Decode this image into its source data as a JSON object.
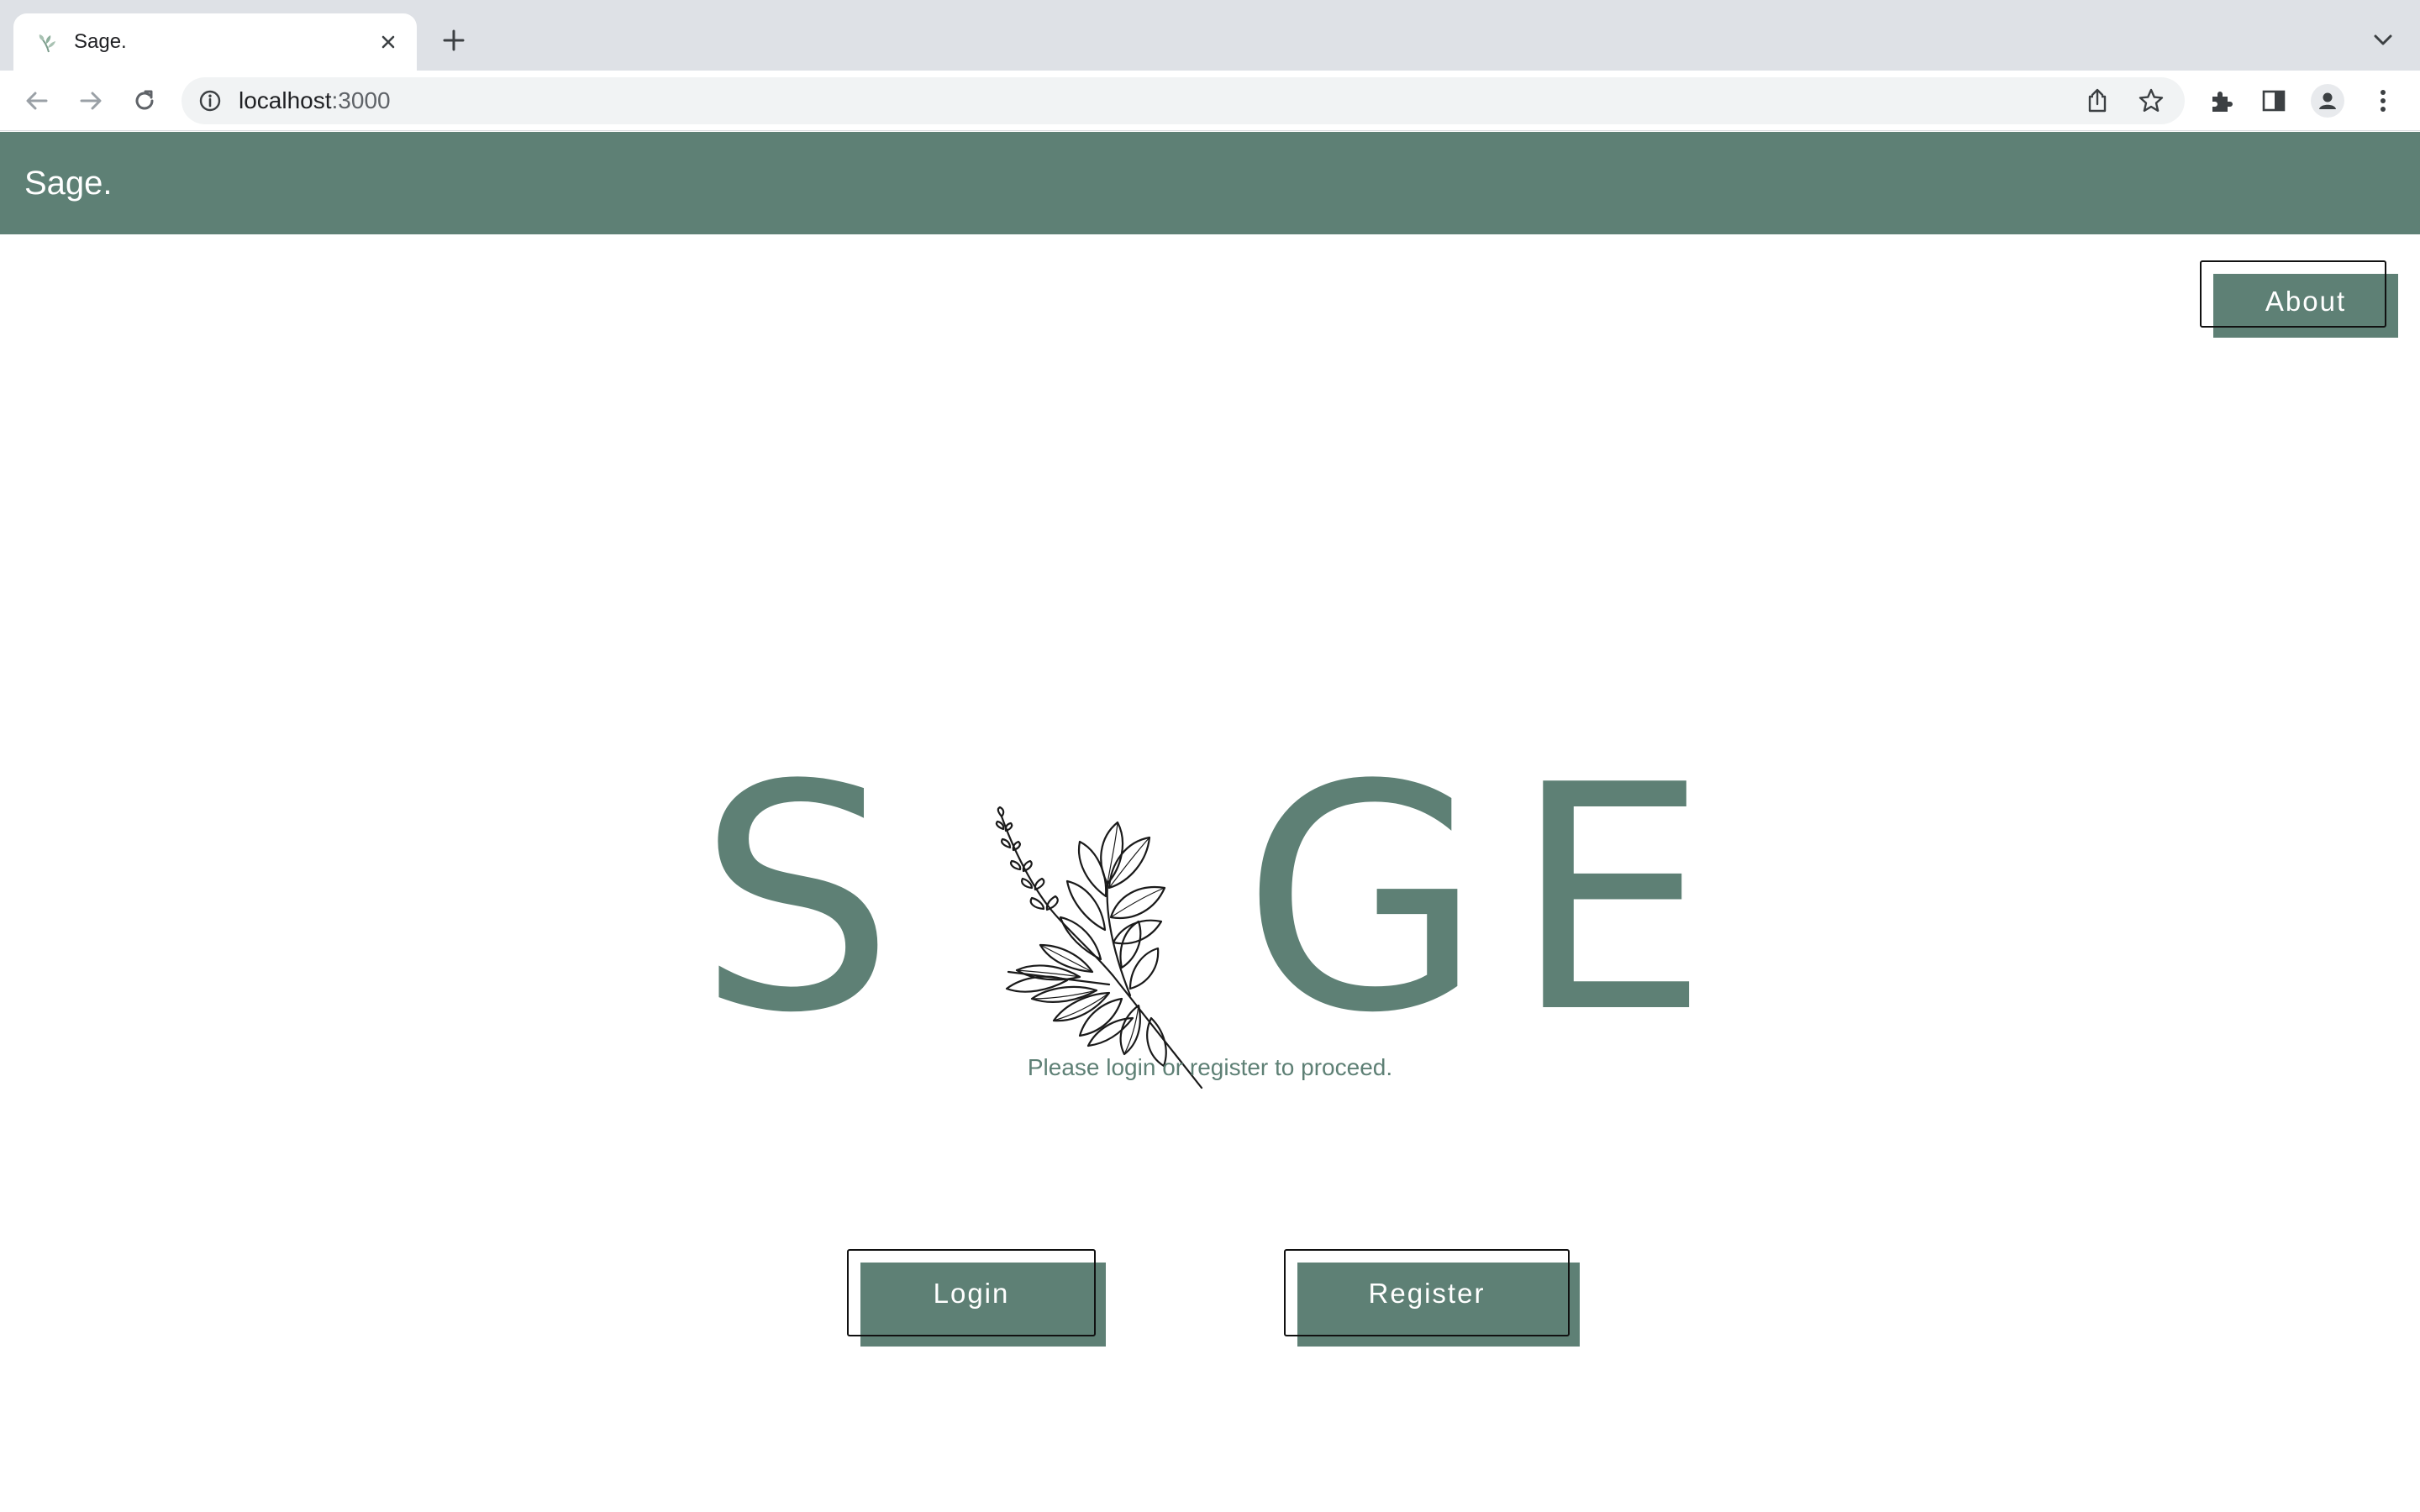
{
  "browser": {
    "tab_title": "Sage.",
    "url_host": "localhost",
    "url_port": ":3000"
  },
  "app": {
    "brand": "Sage.",
    "about_label": "About",
    "logo_letters": [
      "S",
      "G",
      "E"
    ],
    "prompt": "Please login or register to proceed.",
    "login_label": "Login",
    "register_label": "Register"
  },
  "colors": {
    "accent": "#5e8075",
    "header_text": "#ffffff",
    "chrome_bg": "#dee1e6"
  },
  "icons": {
    "favicon": "sage-leaf-icon",
    "tab_close": "close-icon",
    "new_tab": "plus-icon",
    "tab_list": "chevron-down-icon",
    "back": "back-arrow-icon",
    "forward": "forward-arrow-icon",
    "reload": "reload-icon",
    "site_info": "info-icon",
    "share": "share-icon",
    "bookmark": "star-icon",
    "extensions": "puzzle-icon",
    "side_panel": "side-panel-icon",
    "profile": "profile-icon",
    "menu": "kebab-menu-icon",
    "logo_sprig": "sage-sprig-icon"
  }
}
